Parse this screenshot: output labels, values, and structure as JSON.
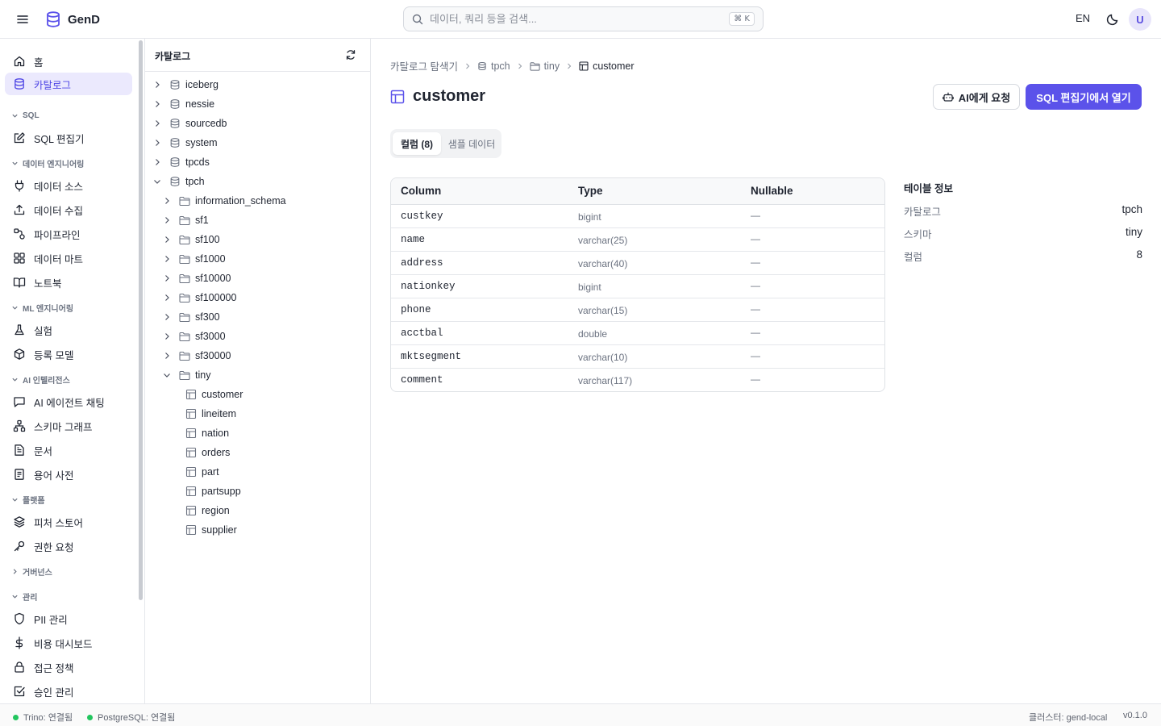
{
  "header": {
    "app_name": "GenD",
    "search_placeholder": "데이터, 쿼리 등을 검색...",
    "search_shortcut": "⌘ K",
    "lang": "EN",
    "avatar_initial": "U",
    "accent_color": "#5b52ea"
  },
  "nav": {
    "items_top": [
      {
        "label": "홈",
        "icon": "home-icon"
      },
      {
        "label": "카탈로그",
        "icon": "database-icon",
        "active": true
      }
    ],
    "sections": [
      {
        "label": "SQL",
        "expanded": true,
        "items": [
          {
            "label": "SQL 편집기",
            "icon": "edit-icon"
          }
        ]
      },
      {
        "label": "데이터 엔지니어링",
        "expanded": true,
        "items": [
          {
            "label": "데이터 소스",
            "icon": "plug-icon"
          },
          {
            "label": "데이터 수집",
            "icon": "upload-icon"
          },
          {
            "label": "파이프라인",
            "icon": "pipeline-icon"
          },
          {
            "label": "데이터 마트",
            "icon": "grid-icon"
          },
          {
            "label": "노트북",
            "icon": "book-icon"
          }
        ]
      },
      {
        "label": "ML 엔지니어링",
        "expanded": true,
        "items": [
          {
            "label": "실험",
            "icon": "flask-icon"
          },
          {
            "label": "등록 모델",
            "icon": "box-icon"
          }
        ]
      },
      {
        "label": "AI 인텔리전스",
        "expanded": true,
        "items": [
          {
            "label": "AI 에이전트 채팅",
            "icon": "chat-icon"
          },
          {
            "label": "스키마 그래프",
            "icon": "network-icon"
          },
          {
            "label": "문서",
            "icon": "document-icon"
          },
          {
            "label": "용어 사전",
            "icon": "dictionary-icon"
          }
        ]
      },
      {
        "label": "플랫폼",
        "expanded": true,
        "items": [
          {
            "label": "피처 스토어",
            "icon": "layers-icon"
          },
          {
            "label": "권한 요청",
            "icon": "key-icon"
          }
        ]
      },
      {
        "label": "거버넌스",
        "expanded": false,
        "items": []
      },
      {
        "label": "관리",
        "expanded": true,
        "items": [
          {
            "label": "PII 관리",
            "icon": "shield-icon"
          },
          {
            "label": "비용 대시보드",
            "icon": "dollar-icon"
          },
          {
            "label": "접근 정책",
            "icon": "lock-icon"
          },
          {
            "label": "승인 관리",
            "icon": "check-square-icon"
          }
        ]
      }
    ]
  },
  "tree": {
    "title": "카탈로그",
    "catalogs": [
      "iceberg",
      "nessie",
      "sourcedb",
      "system",
      "tpcds",
      "tpch"
    ],
    "schemas": [
      "information_schema",
      "sf1",
      "sf100",
      "sf1000",
      "sf10000",
      "sf100000",
      "sf300",
      "sf3000",
      "sf30000",
      "tiny"
    ],
    "tables": [
      "customer",
      "lineitem",
      "nation",
      "orders",
      "part",
      "partsupp",
      "region",
      "supplier"
    ]
  },
  "main": {
    "breadcrumb": {
      "root": "카탈로그 탐색기",
      "catalog": "tpch",
      "schema": "tiny",
      "table": "customer"
    },
    "title": "customer",
    "ai_button": "AI에게 요청",
    "sql_button": "SQL 편집기에서 열기",
    "tabs": {
      "columns": "컬럼 (8)",
      "sample": "샘플 데이터"
    },
    "table": {
      "headers": {
        "column": "Column",
        "type": "Type",
        "nullable": "Nullable"
      },
      "rows": [
        {
          "name": "custkey",
          "type": "bigint",
          "nullable": "—"
        },
        {
          "name": "name",
          "type": "varchar(25)",
          "nullable": "—"
        },
        {
          "name": "address",
          "type": "varchar(40)",
          "nullable": "—"
        },
        {
          "name": "nationkey",
          "type": "bigint",
          "nullable": "—"
        },
        {
          "name": "phone",
          "type": "varchar(15)",
          "nullable": "—"
        },
        {
          "name": "acctbal",
          "type": "double",
          "nullable": "—"
        },
        {
          "name": "mktsegment",
          "type": "varchar(10)",
          "nullable": "—"
        },
        {
          "name": "comment",
          "type": "varchar(117)",
          "nullable": "—"
        }
      ]
    },
    "info": {
      "title": "테이블 정보",
      "rows": [
        {
          "label": "카탈로그",
          "value": "tpch"
        },
        {
          "label": "스키마",
          "value": "tiny"
        },
        {
          "label": "컬럼",
          "value": "8"
        }
      ]
    }
  },
  "status": {
    "trino": "Trino: 연결됨",
    "postgres": "PostgreSQL: 연결됨",
    "cluster": "클러스터: gend-local",
    "version": "v0.1.0",
    "connected_color": "#22c55e"
  }
}
